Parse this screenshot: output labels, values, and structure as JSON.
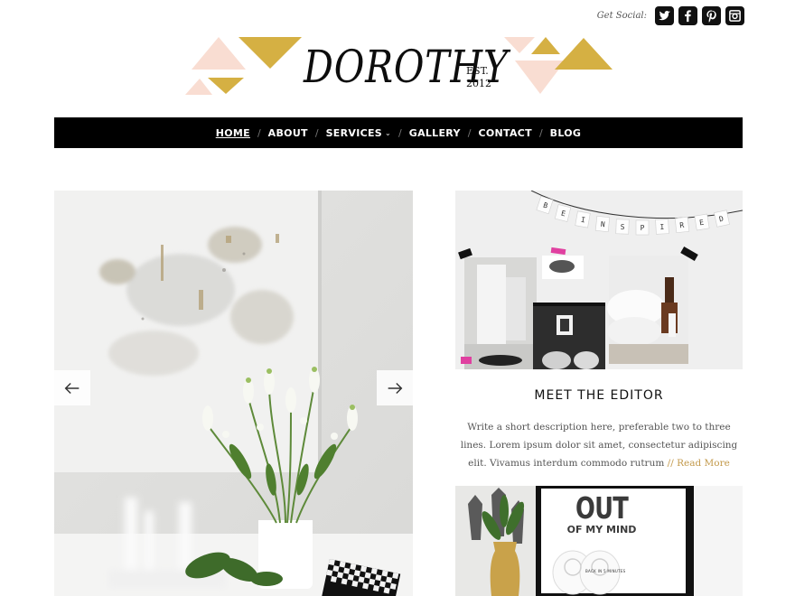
{
  "social": {
    "label": "Get Social:",
    "icons": [
      "twitter-icon",
      "facebook-icon",
      "pinterest-icon",
      "instagram-icon"
    ]
  },
  "logo": {
    "name": "DOROTHY",
    "est": "EST.",
    "year": "2012",
    "colors": {
      "pink": "#f9ddd2",
      "gold": "#d5b043"
    }
  },
  "nav": {
    "items": [
      {
        "label": "HOME",
        "active": true
      },
      {
        "label": "ABOUT"
      },
      {
        "label": "SERVICES",
        "dropdown": true
      },
      {
        "label": "GALLERY"
      },
      {
        "label": "CONTACT"
      },
      {
        "label": "BLOG"
      }
    ],
    "separator": "/"
  },
  "slider": {
    "prev_icon": "arrow-left-icon",
    "next_icon": "arrow-right-icon"
  },
  "editor": {
    "banner": "BE INSPIRED",
    "title": "MEET THE EDITOR",
    "description": "Write a short description here, preferable two to three lines. Lorem ipsum dolor sit amet, consectetur adipiscing elit. Vivamus interdum commodo rutrum",
    "separator": "//",
    "read_more": "Read More"
  },
  "poster": {
    "line1": "OUT",
    "line2": "OF MY MIND",
    "caption": "BACK IN 5 MINUTES"
  },
  "colors": {
    "nav_bg": "#000000",
    "accent_gold": "#c39a4c"
  }
}
